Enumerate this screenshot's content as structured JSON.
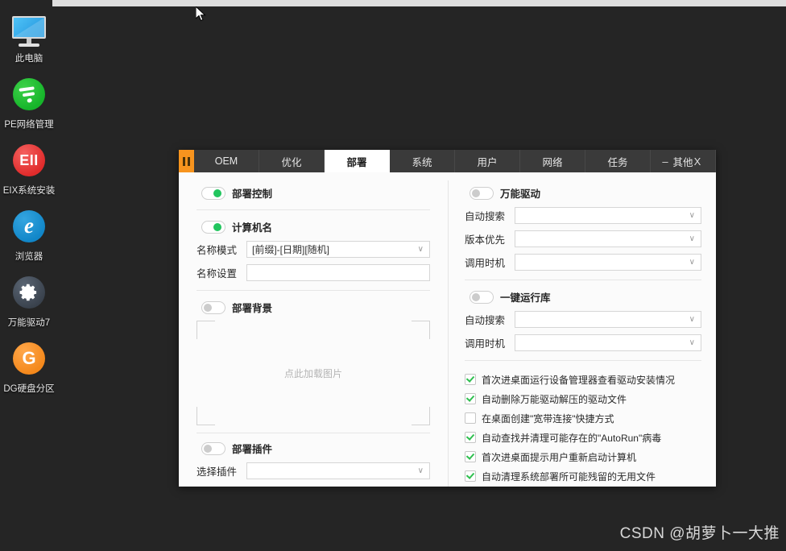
{
  "desktop": {
    "icons": [
      {
        "name": "this-pc",
        "label": "此电脑",
        "icon": "monitor-icon"
      },
      {
        "name": "pe-network-manager",
        "label": "PE网络管理",
        "icon": "wifi-circle-icon"
      },
      {
        "name": "eix-system-install",
        "label": "EIX系统安装",
        "icon": "eix-icon",
        "glyph": "EII"
      },
      {
        "name": "browser",
        "label": "浏览器",
        "icon": "internet-explorer-icon",
        "glyph": "e"
      },
      {
        "name": "universal-driver-7",
        "label": "万能驱动7",
        "icon": "gear-icon"
      },
      {
        "name": "dg-disk-partition",
        "label": "DG硬盘分区",
        "icon": "dg-icon",
        "glyph": "G"
      }
    ],
    "watermark": "CSDN @胡萝卜一大推"
  },
  "window": {
    "tabs": [
      {
        "name": "tab-oem",
        "label": "OEM",
        "active": false
      },
      {
        "name": "tab-optimize",
        "label": "优化",
        "active": false
      },
      {
        "name": "tab-deploy",
        "label": "部署",
        "active": true
      },
      {
        "name": "tab-system",
        "label": "系统",
        "active": false
      },
      {
        "name": "tab-user",
        "label": "用户",
        "active": false
      },
      {
        "name": "tab-network",
        "label": "网络",
        "active": false
      },
      {
        "name": "tab-task",
        "label": "任务",
        "active": false
      },
      {
        "name": "tab-other",
        "label": "其他",
        "active": false
      }
    ],
    "controls": {
      "minimize": "–",
      "close": "X"
    },
    "left": {
      "deploy_control": {
        "label": "部署控制",
        "on": true
      },
      "computer_name": {
        "label": "计算机名",
        "on": true
      },
      "name_pattern": {
        "label": "名称模式",
        "value": "[前缀]-[日期][随机]",
        "caret": "∨"
      },
      "name_setting": {
        "label": "名称设置",
        "value": ""
      },
      "deploy_background": {
        "label": "部署背景",
        "on": false
      },
      "image_hint": "点此加载图片",
      "deploy_plugin": {
        "label": "部署插件",
        "on": false
      },
      "select_plugin": {
        "label": "选择插件",
        "value": "",
        "caret": "∨"
      }
    },
    "right": {
      "universal_driver": {
        "label": "万能驱动",
        "on": false
      },
      "driver_fields": [
        {
          "name": "driver-auto-search",
          "label": "自动搜索",
          "value": "",
          "caret": "∨"
        },
        {
          "name": "driver-version-priority",
          "label": "版本优先",
          "value": "",
          "caret": "∨"
        },
        {
          "name": "driver-call-timing",
          "label": "调用时机",
          "value": "",
          "caret": "∨"
        }
      ],
      "runtime_library": {
        "label": "一键运行库",
        "on": false
      },
      "runtime_fields": [
        {
          "name": "runtime-auto-search",
          "label": "自动搜索",
          "value": "",
          "caret": "∨"
        },
        {
          "name": "runtime-call-timing",
          "label": "调用时机",
          "value": "",
          "caret": "∨"
        }
      ],
      "checkboxes": [
        {
          "name": "check-run-device-manager",
          "label": "首次进桌面运行设备管理器查看驱动安装情况",
          "checked": true
        },
        {
          "name": "check-delete-driver-files",
          "label": "自动删除万能驱动解压的驱动文件",
          "checked": true
        },
        {
          "name": "check-create-broadband-shortcut",
          "label": "在桌面创建\"宽带连接\"快捷方式",
          "checked": false
        },
        {
          "name": "check-clean-autorun-virus",
          "label": "自动查找并清理可能存在的\"AutoRun\"病毒",
          "checked": true
        },
        {
          "name": "check-prompt-restart",
          "label": "首次进桌面提示用户重新启动计算机",
          "checked": true
        },
        {
          "name": "check-clean-residual-files",
          "label": "自动清理系统部署所可能残留的无用文件",
          "checked": true
        }
      ]
    }
  }
}
